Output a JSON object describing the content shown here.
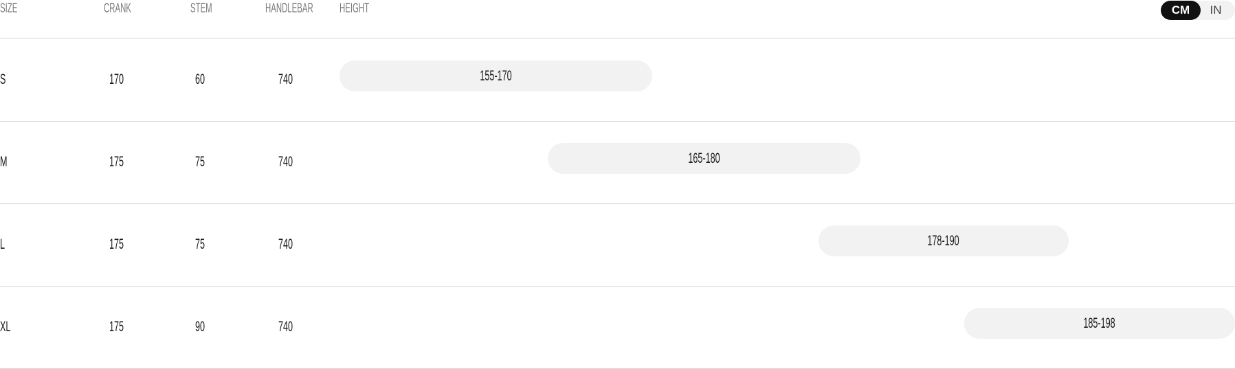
{
  "header": {
    "columns": [
      "SIZE",
      "CRANK",
      "STEM",
      "HANDLEBAR",
      "HEIGHT"
    ]
  },
  "unit_toggle": {
    "options": [
      "CM",
      "IN"
    ],
    "selected": "CM",
    "active_bg": "#111111"
  },
  "height_scale": {
    "min": 155,
    "max": 198,
    "unit": "cm"
  },
  "rows": [
    {
      "size": "S",
      "crank": "170",
      "stem": "60",
      "handlebar": "740",
      "height_label": "155-170",
      "height_min": 155,
      "height_max": 170
    },
    {
      "size": "M",
      "crank": "175",
      "stem": "75",
      "handlebar": "740",
      "height_label": "165-180",
      "height_min": 165,
      "height_max": 180
    },
    {
      "size": "L",
      "crank": "175",
      "stem": "75",
      "handlebar": "740",
      "height_label": "178-190",
      "height_min": 178,
      "height_max": 190
    },
    {
      "size": "XL",
      "crank": "175",
      "stem": "90",
      "handlebar": "740",
      "height_label": "185-198",
      "height_min": 185,
      "height_max": 198
    }
  ],
  "colors": {
    "pill_bg": "#f2f2f2",
    "divider": "#d4d4d4",
    "header_text": "#7a7a7a",
    "cell_text": "#1a1a1a"
  }
}
